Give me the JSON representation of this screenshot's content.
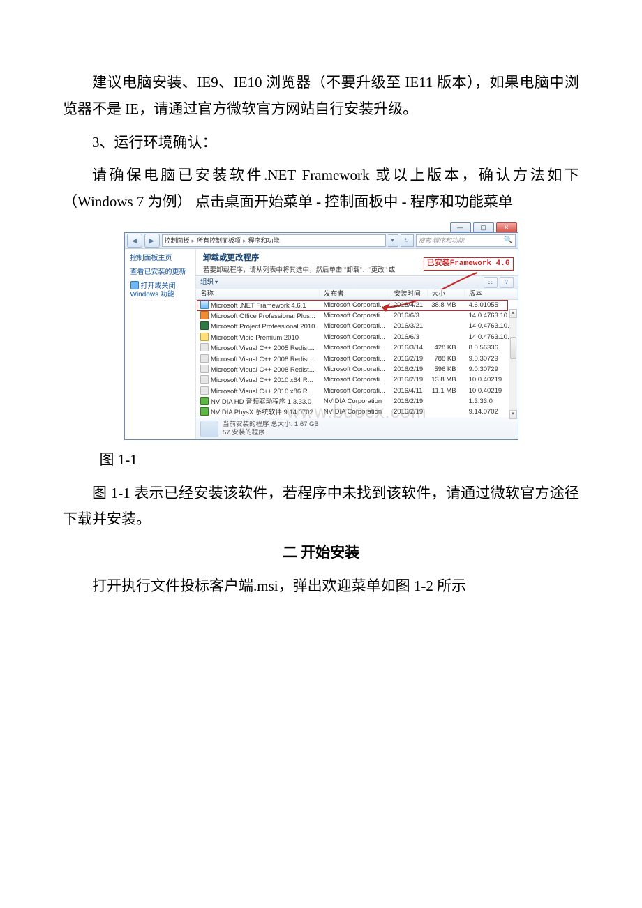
{
  "doc": {
    "p1": "建议电脑安装、IE9、IE10 浏览器（不要升级至 IE11 版本），如果电脑中浏览器不是 IE，请通过官方微软官方网站自行安装升级。",
    "p2": "3、运行环境确认：",
    "p3": "请确保电脑已安装软件.NET Framework 或以上版本，确认方法如下（Windows 7 为例）  点击桌面开始菜单 - 控制面板中 - 程序和功能菜单",
    "caption1": "图 1-1",
    "p4": "图 1-1 表示已经安装该软件，若程序中未找到该软件，请通过微软官方途径下载并安装。",
    "h2": "二 开始安装",
    "p5": "打开执行文件投标客户端.msi，弹出欢迎菜单如图 1-2 所示"
  },
  "win": {
    "title_buttons": {
      "min": "—",
      "max": "▢",
      "close": "✕"
    },
    "nav": {
      "back": "◀",
      "fwd": "▶"
    },
    "breadcrumb": [
      "控制面板",
      "所有控制面板项",
      "程序和功能"
    ],
    "breadcrumb_sep": "▸",
    "search_placeholder": "搜索 程序和功能",
    "sidebar": {
      "home": "控制面板主页",
      "link1": "查看已安装的更新",
      "link2": "打开或关闭 Windows 功能"
    },
    "heading": "卸载或更改程序",
    "subtitle": "若要卸载程序，请从列表中将其选中，然后单击 \"卸载\"、\"更改\" 或",
    "callout": "已安装Framework 4.6",
    "organize": "组织",
    "columns": [
      "名称",
      "发布者",
      "安装时间",
      "大小",
      "版本"
    ],
    "rows": [
      {
        "ico": "net",
        "name": "Microsoft .NET Framework 4.6.1",
        "pub": "Microsoft Corporati...",
        "date": "2016/4/21",
        "size": "38.8 MB",
        "ver": "4.6.01055"
      },
      {
        "ico": "ofc",
        "name": "Microsoft Office Professional Plus...",
        "pub": "Microsoft Corporati...",
        "date": "2016/6/3",
        "size": "",
        "ver": "14.0.4763.10..."
      },
      {
        "ico": "prj",
        "name": "Microsoft Project Professional 2010",
        "pub": "Microsoft Corporati...",
        "date": "2016/3/21",
        "size": "",
        "ver": "14.0.4763.10..."
      },
      {
        "ico": "vis",
        "name": "Microsoft Visio Premium 2010",
        "pub": "Microsoft Corporati...",
        "date": "2016/6/3",
        "size": "",
        "ver": "14.0.4763.10..."
      },
      {
        "ico": "vc",
        "name": "Microsoft Visual C++ 2005 Redist...",
        "pub": "Microsoft Corporati...",
        "date": "2016/3/14",
        "size": "428 KB",
        "ver": "8.0.56336"
      },
      {
        "ico": "vc",
        "name": "Microsoft Visual C++ 2008 Redist...",
        "pub": "Microsoft Corporati...",
        "date": "2016/2/19",
        "size": "788 KB",
        "ver": "9.0.30729"
      },
      {
        "ico": "vc",
        "name": "Microsoft Visual C++ 2008 Redist...",
        "pub": "Microsoft Corporati...",
        "date": "2016/2/19",
        "size": "596 KB",
        "ver": "9.0.30729"
      },
      {
        "ico": "vc",
        "name": "Microsoft Visual C++ 2010  x64 R...",
        "pub": "Microsoft Corporati...",
        "date": "2016/2/19",
        "size": "13.8 MB",
        "ver": "10.0.40219"
      },
      {
        "ico": "vc",
        "name": "Microsoft Visual C++ 2010  x86 R...",
        "pub": "Microsoft Corporati...",
        "date": "2016/4/11",
        "size": "11.1 MB",
        "ver": "10.0.40219"
      },
      {
        "ico": "nvd",
        "name": "NVIDIA HD 音频驱动程序 1.3.33.0",
        "pub": "NVIDIA Corporation",
        "date": "2016/2/19",
        "size": "",
        "ver": "1.3.33.0"
      },
      {
        "ico": "nvd",
        "name": "NVIDIA PhysX 系统软件 9.14.0702",
        "pub": "NVIDIA Corporation",
        "date": "2016/2/19",
        "size": "",
        "ver": "9.14.0702"
      }
    ],
    "status_line1": "当前安装的程序  总大小: 1.67 GB",
    "status_line2": "57 安装的程序",
    "watermark": "www.bdocx.com"
  }
}
